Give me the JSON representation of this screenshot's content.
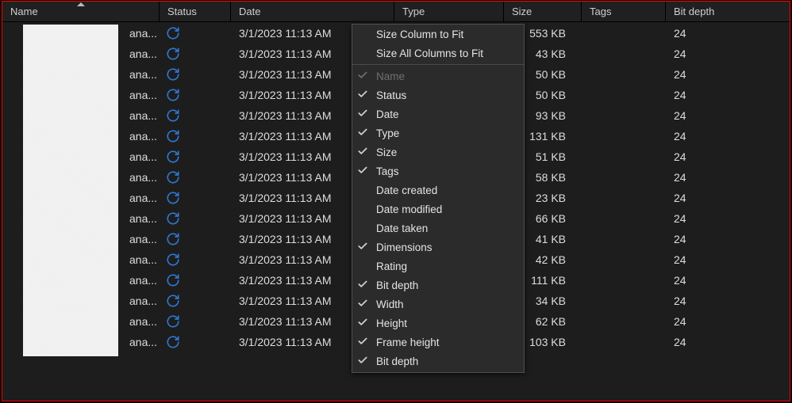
{
  "columns": {
    "name": "Name",
    "status": "Status",
    "date": "Date",
    "type": "Type",
    "size": "Size",
    "tags": "Tags",
    "bit": "Bit depth"
  },
  "rows": [
    {
      "name": "ana...",
      "date": "3/1/2023 11:13 AM",
      "size": "553 KB",
      "bit": "24"
    },
    {
      "name": "ana...",
      "date": "3/1/2023 11:13 AM",
      "size": "43 KB",
      "bit": "24"
    },
    {
      "name": "ana...",
      "date": "3/1/2023 11:13 AM",
      "size": "50 KB",
      "bit": "24"
    },
    {
      "name": "ana...",
      "date": "3/1/2023 11:13 AM",
      "size": "50 KB",
      "bit": "24"
    },
    {
      "name": "ana...",
      "date": "3/1/2023 11:13 AM",
      "size": "93 KB",
      "bit": "24"
    },
    {
      "name": "ana...",
      "date": "3/1/2023 11:13 AM",
      "size": "131 KB",
      "bit": "24"
    },
    {
      "name": "ana...",
      "date": "3/1/2023 11:13 AM",
      "size": "51 KB",
      "bit": "24"
    },
    {
      "name": "ana...",
      "date": "3/1/2023 11:13 AM",
      "size": "58 KB",
      "bit": "24"
    },
    {
      "name": "ana...",
      "date": "3/1/2023 11:13 AM",
      "size": "23 KB",
      "bit": "24"
    },
    {
      "name": "ana...",
      "date": "3/1/2023 11:13 AM",
      "size": "66 KB",
      "bit": "24"
    },
    {
      "name": "ana...",
      "date": "3/1/2023 11:13 AM",
      "size": "41 KB",
      "bit": "24"
    },
    {
      "name": "ana...",
      "date": "3/1/2023 11:13 AM",
      "size": "42 KB",
      "bit": "24"
    },
    {
      "name": "ana...",
      "date": "3/1/2023 11:13 AM",
      "size": "111 KB",
      "bit": "24"
    },
    {
      "name": "ana...",
      "date": "3/1/2023 11:13 AM",
      "size": "34 KB",
      "bit": "24"
    },
    {
      "name": "ana...",
      "date": "3/1/2023 11:13 AM",
      "size": "62 KB",
      "bit": "24"
    },
    {
      "name": "ana...",
      "date": "3/1/2023 11:13 AM",
      "size": "103 KB",
      "bit": "24"
    }
  ],
  "menu": {
    "size_to_fit": "Size Column to Fit",
    "size_all_to_fit": "Size All Columns to Fit",
    "items": [
      {
        "label": "Name",
        "checked": true,
        "disabled": true
      },
      {
        "label": "Status",
        "checked": true
      },
      {
        "label": "Date",
        "checked": true
      },
      {
        "label": "Type",
        "checked": true
      },
      {
        "label": "Size",
        "checked": true
      },
      {
        "label": "Tags",
        "checked": true
      },
      {
        "label": "Date created",
        "checked": false
      },
      {
        "label": "Date modified",
        "checked": false
      },
      {
        "label": "Date taken",
        "checked": false
      },
      {
        "label": "Dimensions",
        "checked": true
      },
      {
        "label": "Rating",
        "checked": false
      },
      {
        "label": "Bit depth",
        "checked": true
      },
      {
        "label": "Width",
        "checked": true
      },
      {
        "label": "Height",
        "checked": true
      },
      {
        "label": "Frame height",
        "checked": true
      },
      {
        "label": "Bit depth",
        "checked": true
      }
    ]
  },
  "colors": {
    "sync_icon": "#2e77d0",
    "check_icon": "#cfcfcf"
  }
}
